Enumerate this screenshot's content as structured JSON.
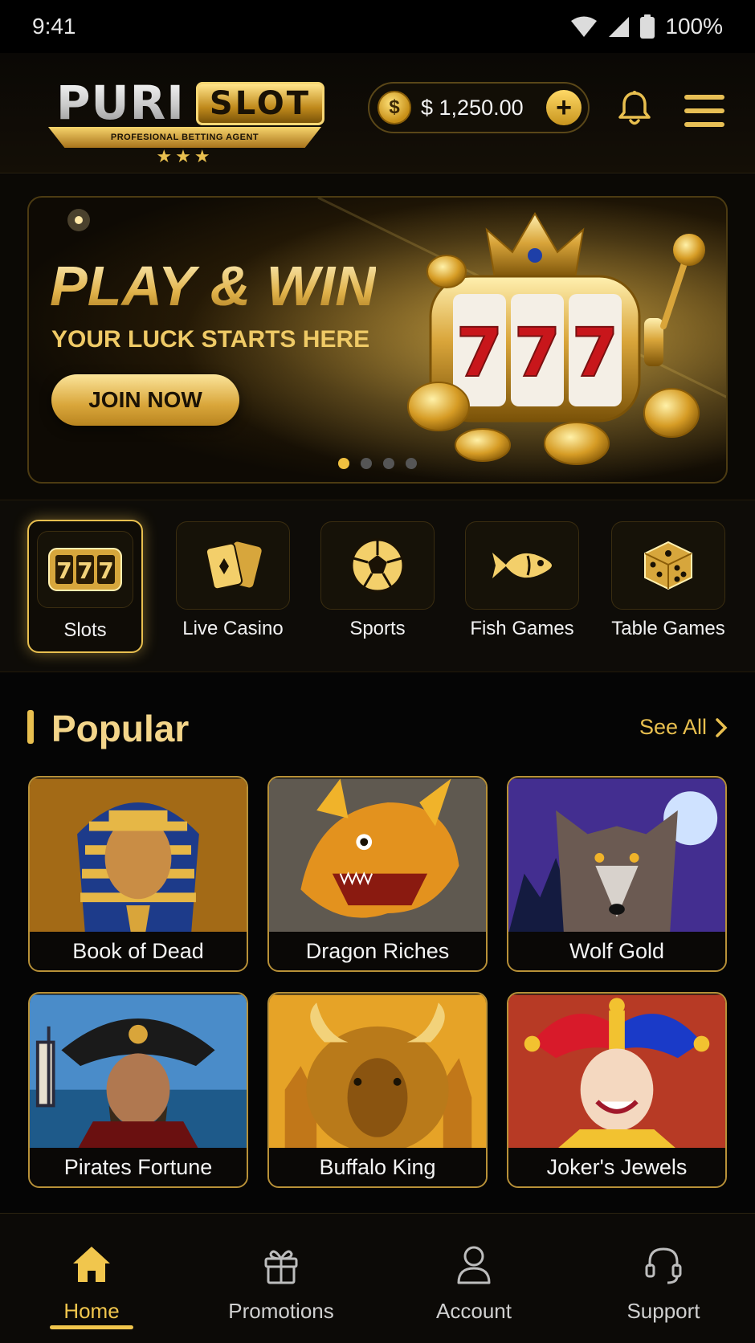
{
  "status_bar": {
    "time": "9:41",
    "battery": "100%"
  },
  "header": {
    "logo": {
      "part1": "PURI",
      "part2": "SLOT",
      "tagline": "PROFESIONAL BETTING AGENT",
      "stars": "★★★"
    },
    "balance": "$ 1,250.00",
    "coin_symbol": "$",
    "add_symbol": "+"
  },
  "banner": {
    "title": "PLAY & WIN",
    "subtitle": "YOUR LUCK STARTS HERE",
    "cta": "JOIN NOW",
    "slide_count": 4,
    "active_slide": 1,
    "reel_digits": [
      "7",
      "7",
      "7"
    ]
  },
  "categories": [
    {
      "label": "Slots",
      "icon": "slot-machine-icon",
      "active": true
    },
    {
      "label": "Live Casino",
      "icon": "cards-icon",
      "active": false
    },
    {
      "label": "Sports",
      "icon": "soccer-ball-icon",
      "active": false
    },
    {
      "label": "Fish Games",
      "icon": "fish-icon",
      "active": false
    },
    {
      "label": "Table Games",
      "icon": "dice-icon",
      "active": false
    }
  ],
  "popular": {
    "title": "Popular",
    "see_all": "See All",
    "games": [
      {
        "name": "Book of Dead"
      },
      {
        "name": "Dragon Riches"
      },
      {
        "name": "Wolf Gold"
      },
      {
        "name": "Pirates Fortune"
      },
      {
        "name": "Buffalo King"
      },
      {
        "name": "Joker's Jewels"
      }
    ]
  },
  "bottom_nav": [
    {
      "label": "Home",
      "icon": "home-icon",
      "active": true
    },
    {
      "label": "Promotions",
      "icon": "gift-icon",
      "active": false
    },
    {
      "label": "Account",
      "icon": "user-icon",
      "active": false
    },
    {
      "label": "Support",
      "icon": "headset-icon",
      "active": false
    }
  ],
  "colors": {
    "accent": "#e8bf4f",
    "background": "#050505",
    "card_border": "#b89138"
  }
}
